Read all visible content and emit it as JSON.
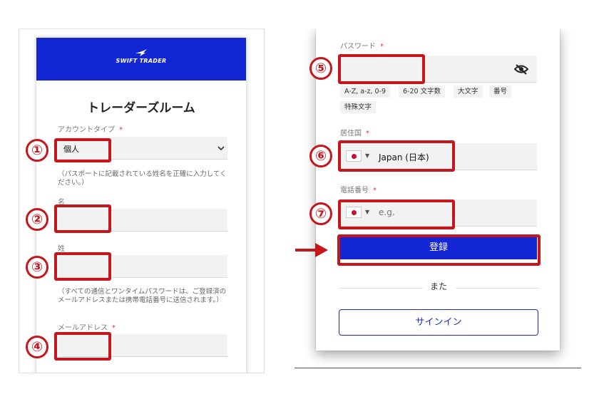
{
  "left_form": {
    "brand": "SWIFT TRADER",
    "title": "トレーダーズルーム",
    "account_type_label": "アカウントタイプ",
    "account_type_value": "個人",
    "name_note": "（パスポートに記載されている姓名を正確に入力してください。）",
    "first_name_label": "名",
    "last_name_label": "姓",
    "email_note": "（すべての通信とワンタイムパスワードは、ご登録済のメールアドレスまたは携帯電話番号に送信されます。）",
    "email_label": "メールアドレス",
    "required_mark": "*"
  },
  "right_form": {
    "password_label": "パスワード",
    "password_rules": [
      "A-Z, a-z, 0-9",
      "6-20 文字数",
      "大文字",
      "番号",
      "特殊文字"
    ],
    "country_label": "居住国",
    "country_value": "Japan (日本)",
    "phone_label": "電話番号",
    "phone_placeholder": "e.g.",
    "register_button": "登録",
    "or_text": "また",
    "signin_button": "サインイン",
    "required_mark": "*"
  },
  "annotations": [
    "①",
    "②",
    "③",
    "④",
    "⑤",
    "⑥",
    "⑦"
  ],
  "colors": {
    "brand_blue": "#1226d4",
    "annotation_red": "#c4161c",
    "required_red": "#d33333"
  }
}
